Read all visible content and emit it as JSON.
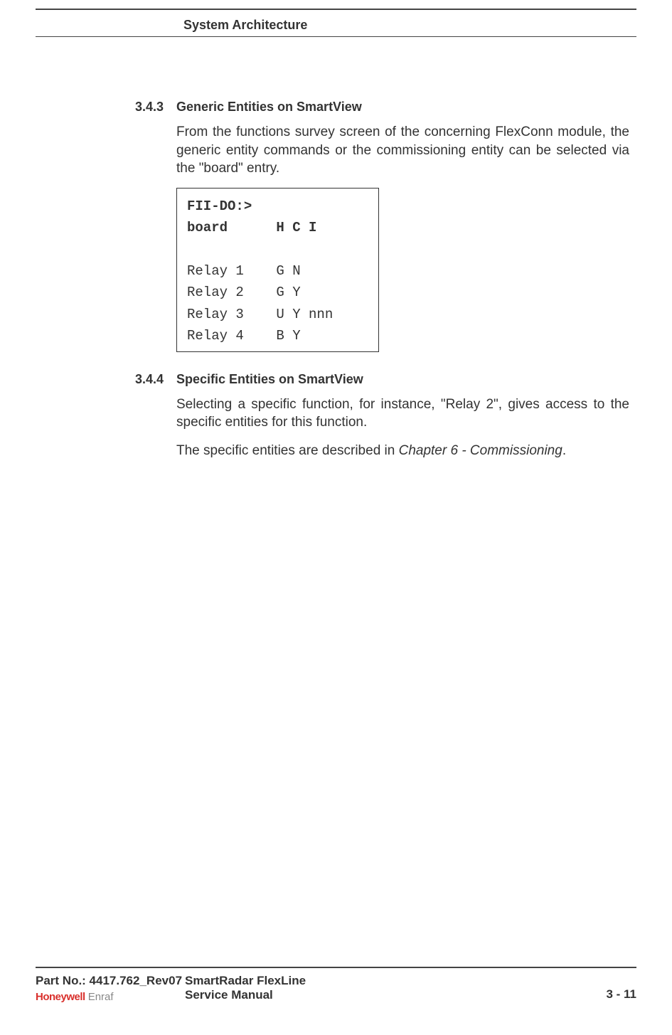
{
  "header": {
    "chapter": "System Architecture"
  },
  "sections": {
    "s343": {
      "num": "3.4.3",
      "title": "Generic Entities on SmartView",
      "body": "From the functions survey screen of the concerning FlexConn module, the generic entity commands or the commissioning entity can be selected via the \"board\" entry."
    },
    "s344": {
      "num": "3.4.4",
      "title": "Specific Entities on SmartView",
      "body1": "Selecting a specific function, for instance, \"Relay 2\", gives access to the specific entities for this function.",
      "body2a": "The specific entities are described in ",
      "body2b": "Chapter 6 - Commissioning",
      "body2c": "."
    }
  },
  "codebox": {
    "line1": "FII-DO:>",
    "line2": "board      H C I",
    "line3": "Relay 1    G N",
    "line4": "Relay 2    G Y",
    "line5": "Relay 3    U Y nnn",
    "line6": "Relay 4    B Y"
  },
  "footer": {
    "part": "Part No.: 4417.762_Rev07",
    "logo1": "Honeywell",
    "logo2": "Enraf",
    "title1": "SmartRadar FlexLine",
    "title2": "Service Manual",
    "page": "3 - 11"
  }
}
